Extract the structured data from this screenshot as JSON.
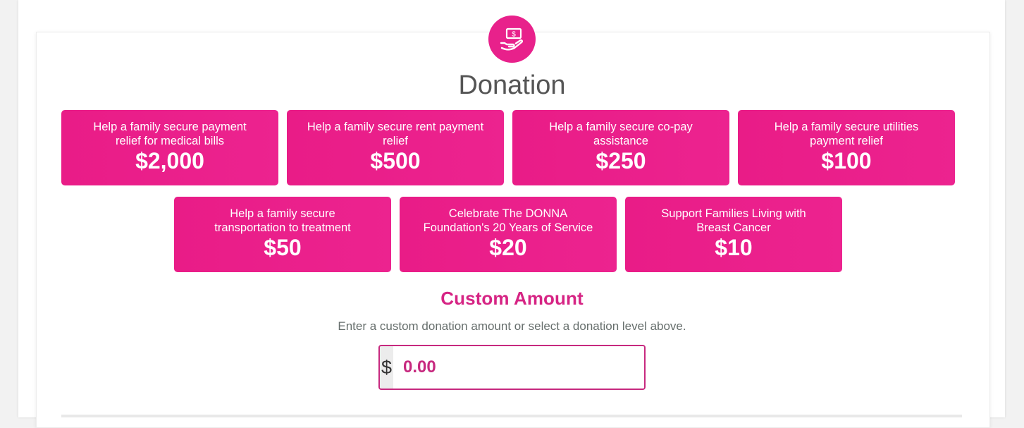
{
  "header": {
    "icon": "hand-holding-money-icon",
    "title": "Donation"
  },
  "colors": {
    "accent": "#e8218b",
    "accent_dark": "#c7297f",
    "title_text": "#555555",
    "help_text": "#666e6c"
  },
  "donation_levels": [
    {
      "description": "Help a family secure payment relief for medical bills",
      "amount": "$2,000"
    },
    {
      "description": "Help a family secure rent payment relief",
      "amount": "$500"
    },
    {
      "description": "Help a family secure co-pay assistance",
      "amount": "$250"
    },
    {
      "description": "Help a family secure utilities payment relief",
      "amount": "$100"
    },
    {
      "description": "Help a family secure transportation to treatment",
      "amount": "$50"
    },
    {
      "description": "Celebrate The DONNA Foundation's 20 Years of Service",
      "amount": "$20"
    },
    {
      "description": "Support Families Living with Breast Cancer",
      "amount": "$10"
    }
  ],
  "custom_amount": {
    "title": "Custom Amount",
    "help_text": "Enter a custom donation amount or select a donation level above.",
    "currency_symbol": "$",
    "placeholder": "0.00",
    "value": ""
  }
}
